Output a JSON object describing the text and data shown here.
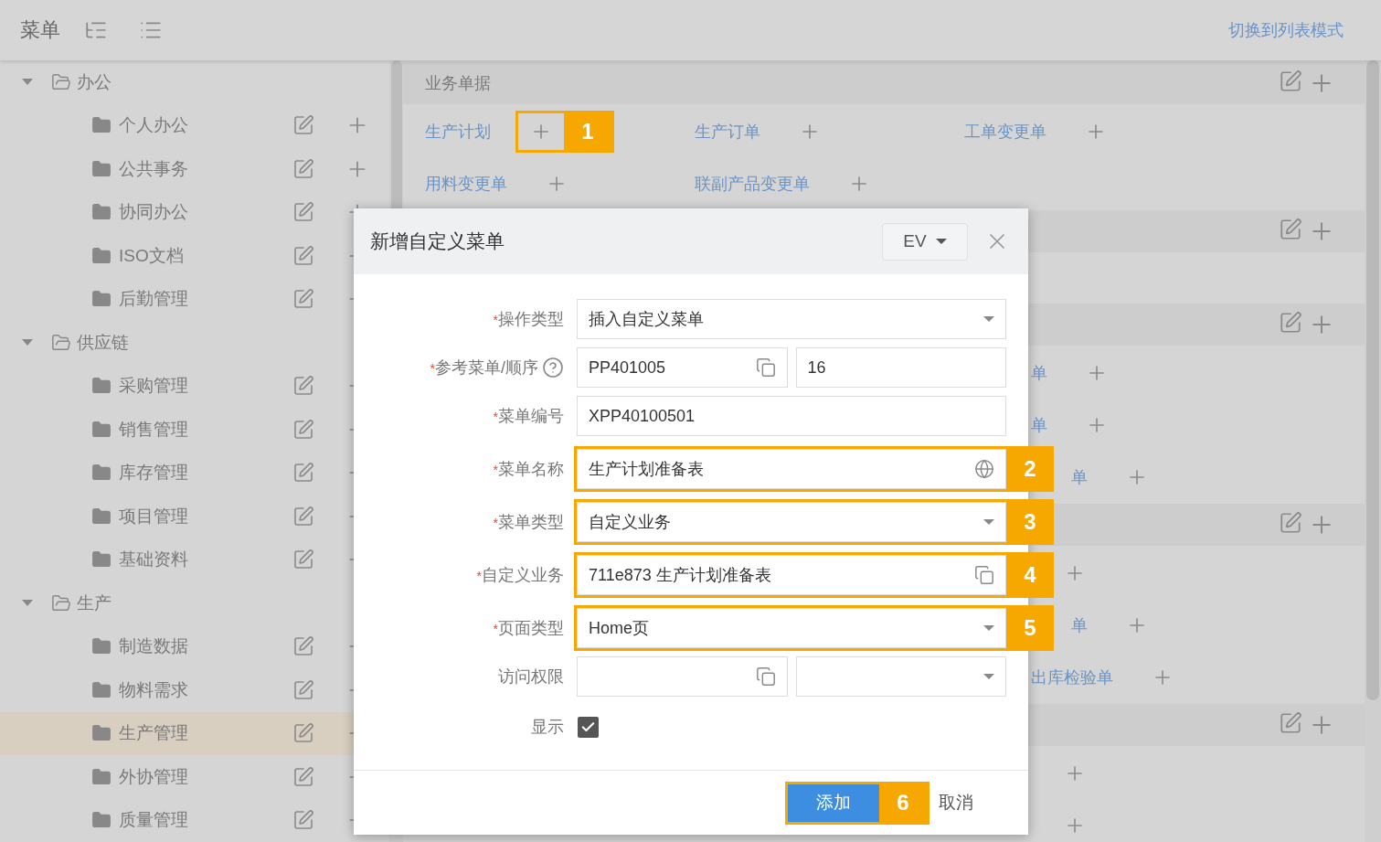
{
  "header": {
    "title": "菜单",
    "switch_link": "切换到列表模式"
  },
  "sidebar": {
    "groups": [
      {
        "label": "办公",
        "expanded": true,
        "children": [
          {
            "label": "个人办公",
            "selected": false
          },
          {
            "label": "公共事务",
            "selected": false
          },
          {
            "label": "协同办公",
            "selected": false
          },
          {
            "label": "ISO文档",
            "selected": false
          },
          {
            "label": "后勤管理",
            "selected": false
          }
        ]
      },
      {
        "label": "供应链",
        "expanded": true,
        "children": [
          {
            "label": "采购管理",
            "selected": false
          },
          {
            "label": "销售管理",
            "selected": false
          },
          {
            "label": "库存管理",
            "selected": false
          },
          {
            "label": "项目管理",
            "selected": false
          },
          {
            "label": "基础资料",
            "selected": false
          }
        ]
      },
      {
        "label": "生产",
        "expanded": true,
        "children": [
          {
            "label": "制造数据",
            "selected": false
          },
          {
            "label": "物料需求",
            "selected": false
          },
          {
            "label": "生产管理",
            "selected": true
          },
          {
            "label": "外协管理",
            "selected": false
          },
          {
            "label": "质量管理",
            "selected": false
          }
        ]
      }
    ]
  },
  "main": {
    "sections": [
      {
        "kind": "group",
        "title": "业务单据",
        "rows": [
          [
            {
              "kind": "link",
              "label": "生产计划",
              "callout": "1"
            },
            {
              "kind": "link",
              "label": "生产订单"
            },
            {
              "kind": "link",
              "label": "工单变更单"
            }
          ],
          [
            {
              "kind": "link",
              "label": "用料变更单"
            },
            {
              "kind": "link",
              "label": "联副产品变更单"
            }
          ]
        ]
      },
      {
        "kind": "group"
      },
      {
        "kind": "group",
        "rows": [
          [
            {
              "kind": "partial",
              "label": "单"
            }
          ],
          [
            {
              "kind": "partial",
              "label": "单"
            }
          ],
          [
            {
              "kind": "clipped",
              "label": "单"
            }
          ]
        ]
      },
      {
        "kind": "group",
        "rows": [
          [
            {
              "kind": "partial"
            }
          ],
          [
            {
              "kind": "clipped",
              "label": "单"
            }
          ],
          [
            {
              "kind": "partial",
              "label": "出库检验单"
            }
          ]
        ]
      },
      {
        "kind": "group",
        "rows": [
          [
            {
              "kind": "partial"
            }
          ],
          [
            {
              "kind": "partial"
            }
          ]
        ]
      }
    ]
  },
  "dialog": {
    "title": "新增自定义菜单",
    "language": "EV",
    "fields": [
      {
        "kind": "inputs",
        "label": "操作类型",
        "marker": "*",
        "inputs": [
          {
            "kind": "select",
            "value": "插入自定义菜单"
          }
        ]
      },
      {
        "kind": "inputs",
        "label": "参考菜单/顺序",
        "marker": "*",
        "help": true,
        "inputs": [
          {
            "kind": "copy",
            "value": "PP401005"
          },
          {
            "kind": "text",
            "value": "16"
          }
        ]
      },
      {
        "kind": "inputs",
        "label": "菜单编号",
        "marker": "*",
        "inputs": [
          {
            "kind": "text",
            "value": "XPP40100501"
          }
        ]
      },
      {
        "kind": "inputs",
        "label": "菜单名称",
        "marker": "*",
        "callout": "2",
        "inputs": [
          {
            "kind": "globe",
            "value": "生产计划准备表"
          }
        ]
      },
      {
        "kind": "inputs",
        "label": "菜单类型",
        "marker": "*",
        "callout": "3",
        "inputs": [
          {
            "kind": "select",
            "value": "自定义业务"
          }
        ]
      },
      {
        "kind": "inputs",
        "label": "自定义业务",
        "marker": "*",
        "callout": "4",
        "inputs": [
          {
            "kind": "copy",
            "value": "711e873 生产计划准备表"
          }
        ]
      },
      {
        "kind": "inputs",
        "label": "页面类型",
        "marker": "*",
        "callout": "5",
        "inputs": [
          {
            "kind": "select",
            "value": "Home页"
          }
        ]
      },
      {
        "kind": "inputs",
        "label": "访问权限",
        "inputs": [
          {
            "kind": "copy"
          },
          {
            "kind": "select"
          }
        ]
      },
      {
        "kind": "checkbox",
        "label": "显示",
        "checked": true
      }
    ],
    "buttons": [
      {
        "kind": "primary",
        "label": "添加",
        "callout": "6"
      },
      {
        "kind": "plain",
        "label": "取消"
      }
    ]
  }
}
